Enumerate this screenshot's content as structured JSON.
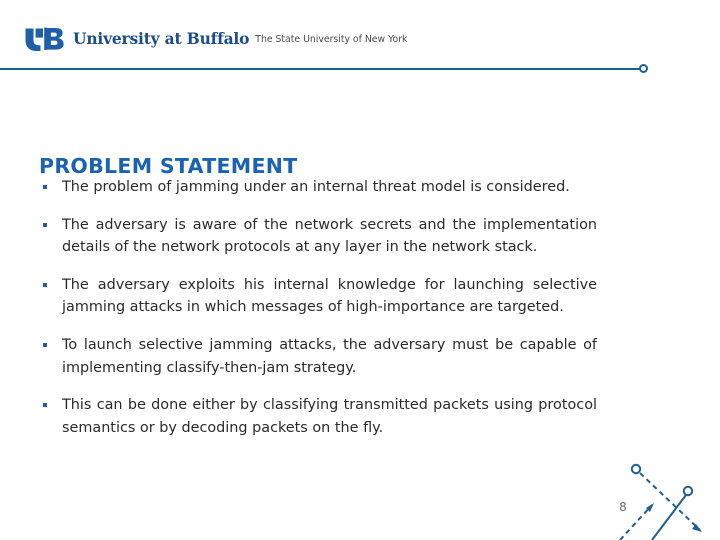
{
  "brand": {
    "logo_icon": "ub-monogram-icon",
    "wordmark": "University at Buffalo",
    "tagline": "The State University of New York",
    "wordmark_color": "#1b4d8e",
    "divider_color": "#1c5f96"
  },
  "slide": {
    "title": "PROBLEM STATEMENT",
    "title_color": "#1b63b0",
    "body_color": "#2b2b2b",
    "bullet_marker_color": "#1f5fa8",
    "bullets": [
      {
        "text": "The problem of jamming under an internal threat model is considered."
      },
      {
        "text": "The adversary is aware of the network secrets and the implementation details of the network protocols at any layer in the network stack."
      },
      {
        "text": "The adversary exploits his internal knowledge for launching selective jamming attacks in which messages of high-importance are targeted."
      },
      {
        "text": "To launch selective jamming attacks, the adversary must be capable of implementing classify-then-jam strategy."
      },
      {
        "text": "This can be done either by classifying transmitted packets using protocol semantics or by decoding packets on the fly."
      }
    ]
  },
  "footer": {
    "page_number": "8",
    "page_number_color": "#6b6b6b",
    "motif_icon": "crossing-dashed-arrows-decoration",
    "motif_color": "#1c5f96"
  }
}
